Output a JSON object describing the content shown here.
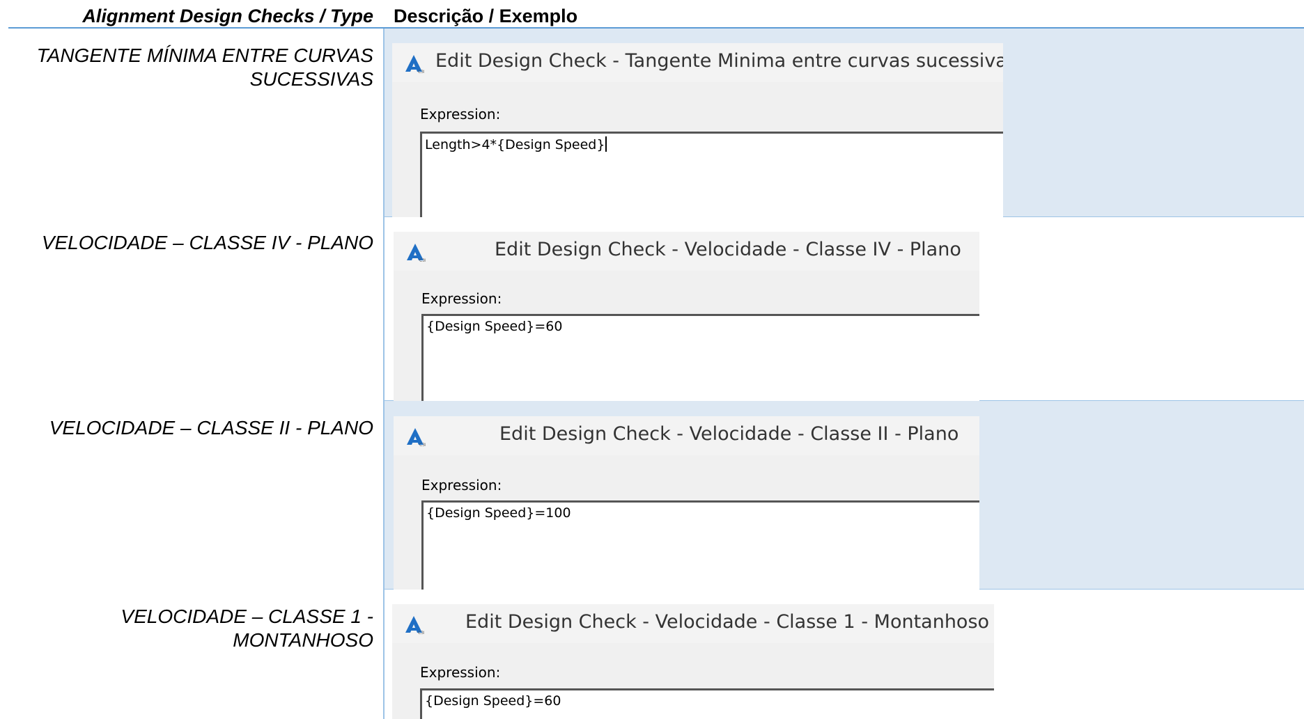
{
  "header": {
    "col1": "Alignment Design Checks / Type",
    "col2": "Descrição / Exemplo"
  },
  "rows": [
    {
      "label": "TANGENTE MÍNIMA ENTRE CURVAS SUCESSIVAS",
      "dialog_title": "Edit Design Check - Tangente Minima entre curvas sucessivas",
      "expression_label": "Expression:",
      "expression_value": "Length>4*{Design Speed}"
    },
    {
      "label": "VELOCIDADE – CLASSE IV - PLANO",
      "dialog_title": "Edit Design Check - Velocidade - Classe IV - Plano",
      "expression_label": "Expression:",
      "expression_value": "{Design Speed}=60"
    },
    {
      "label": "VELOCIDADE – CLASSE II - PLANO",
      "dialog_title": "Edit Design Check - Velocidade - Classe II - Plano",
      "expression_label": "Expression:",
      "expression_value": "{Design Speed}=100"
    },
    {
      "label": "VELOCIDADE – CLASSE 1 - MONTANHOSO",
      "dialog_title": "Edit Design Check - Velocidade - Classe 1 - Montanhoso",
      "expression_label": "Expression:",
      "expression_value": "{Design Speed}=60"
    }
  ],
  "colors": {
    "shade": "#dde8f3",
    "rule": "#5b9bd5",
    "icon_blue": "#1f6fc5"
  },
  "icons": {
    "app_icon": "civil3d-app-icon"
  }
}
